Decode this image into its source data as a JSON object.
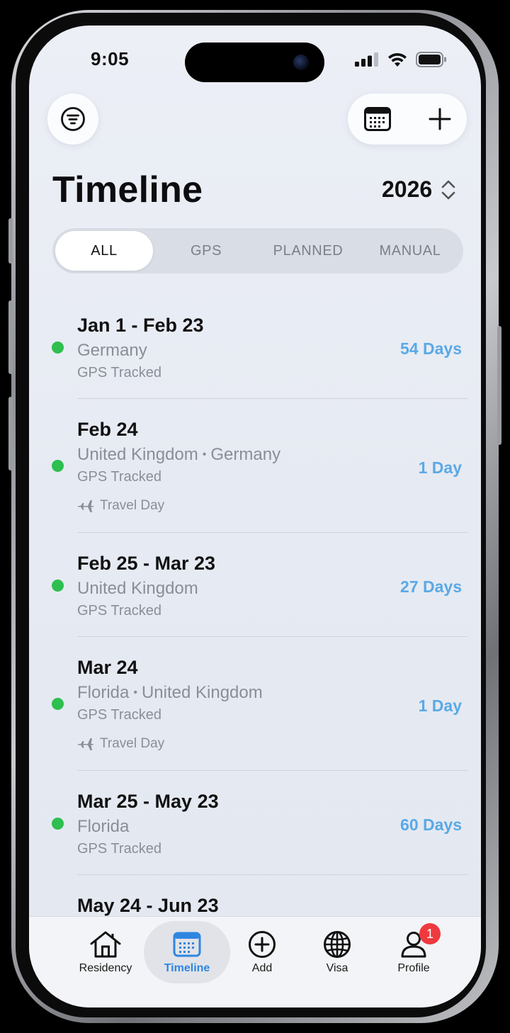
{
  "status_bar": {
    "time": "9:05"
  },
  "header": {
    "filter_icon": "filter-icon",
    "calendar_icon": "calendar-icon",
    "add_icon": "plus-icon"
  },
  "page": {
    "title": "Timeline",
    "year": "2026"
  },
  "segments": [
    {
      "label": "ALL",
      "active": true
    },
    {
      "label": "GPS",
      "active": false
    },
    {
      "label": "PLANNED",
      "active": false
    },
    {
      "label": "MANUAL",
      "active": false
    }
  ],
  "entries": [
    {
      "date": "Jan 1 - Feb 23",
      "places": [
        "Germany"
      ],
      "source": "GPS Tracked",
      "travel": "",
      "days": "54 Days",
      "status_color": "#2dbf4f"
    },
    {
      "date": "Feb 24",
      "places": [
        "United Kingdom",
        "Germany"
      ],
      "source": "GPS Tracked",
      "travel": "Travel Day",
      "days": "1 Day",
      "status_color": "#2dbf4f"
    },
    {
      "date": "Feb 25 - Mar 23",
      "places": [
        "United Kingdom"
      ],
      "source": "GPS Tracked",
      "travel": "",
      "days": "27 Days",
      "status_color": "#2dbf4f"
    },
    {
      "date": "Mar 24",
      "places": [
        "Florida",
        "United Kingdom"
      ],
      "source": "GPS Tracked",
      "travel": "Travel Day",
      "days": "1 Day",
      "status_color": "#2dbf4f"
    },
    {
      "date": "Mar 25 - May 23",
      "places": [
        "Florida"
      ],
      "source": "GPS Tracked",
      "travel": "",
      "days": "60 Days",
      "status_color": "#2dbf4f"
    },
    {
      "date": "May 24 - Jun 23",
      "places": [],
      "source": "",
      "travel": "",
      "days": "",
      "status_color": "#2dbf4f"
    }
  ],
  "place_separator": "•",
  "tab_bar": {
    "tabs": [
      {
        "label": "Residency",
        "icon": "house-icon",
        "active": false
      },
      {
        "label": "Timeline",
        "icon": "calendar-icon",
        "active": true
      },
      {
        "label": "Add",
        "icon": "plus-circle-icon",
        "active": false
      },
      {
        "label": "Visa",
        "icon": "globe-icon",
        "active": false
      },
      {
        "label": "Profile",
        "icon": "person-icon",
        "active": false
      }
    ],
    "profile_badge": "1"
  },
  "colors": {
    "accent": "#5aa9e6",
    "tab_active": "#2f86e0",
    "status_green": "#2dbf4f",
    "badge_red": "#ee3a3f"
  }
}
